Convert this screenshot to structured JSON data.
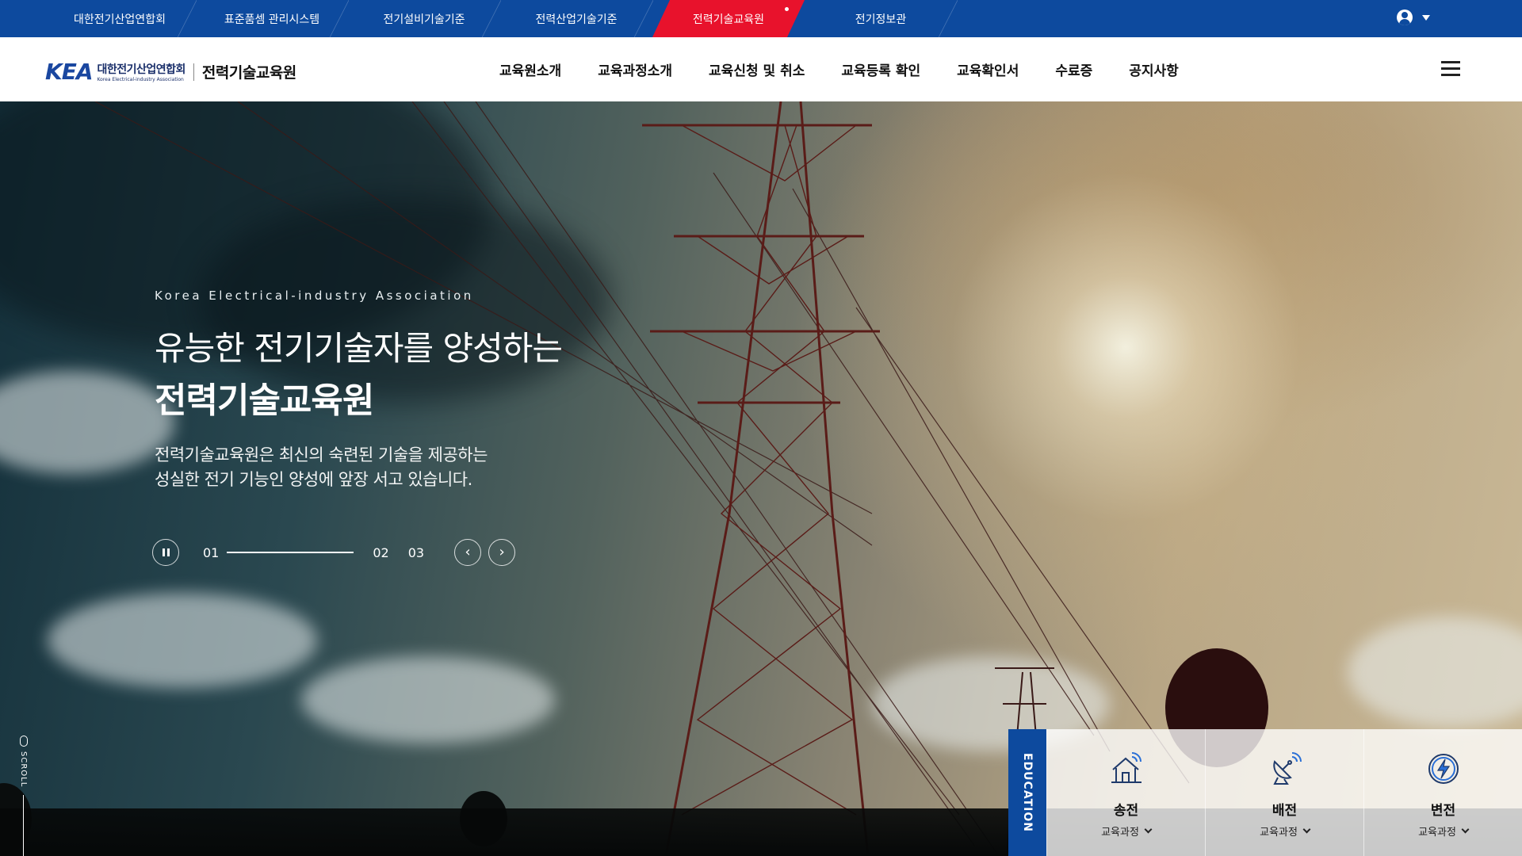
{
  "topbar": {
    "sites": [
      {
        "label": "대한전기산업연합회",
        "active": false
      },
      {
        "label": "표준품셈 관리시스템",
        "active": false
      },
      {
        "label": "전기설비기술기준",
        "active": false
      },
      {
        "label": "전력산업기술기준",
        "active": false
      },
      {
        "label": "전력기술교육원",
        "active": true
      },
      {
        "label": "전기정보관",
        "active": false
      }
    ]
  },
  "header": {
    "logo_mark": "KEA",
    "logo_org": "대한전기산업연합회",
    "logo_org_en": "Korea Electrical-industry Association",
    "logo_sub": "전력기술교육원",
    "nav": [
      "교육원소개",
      "교육과정소개",
      "교육신청 및 취소",
      "교육등록 확인",
      "교육확인서",
      "수료증",
      "공지사항"
    ]
  },
  "hero": {
    "eyebrow": "Korea Electrical-industry Association",
    "title_line1": "유능한 전기기술자를 양성하는",
    "title_line2": "전력기술교육원",
    "desc_line1": "전력기술교육원은 최신의 숙련된 기술을 제공하는",
    "desc_line2": "성실한 전기 기능인 양성에 앞장 서고 있습니다.",
    "slider": {
      "current": "01",
      "others": [
        "02",
        "03"
      ],
      "progress": 1.0
    },
    "scroll_label": "SCROLL"
  },
  "education": {
    "tab_label": "EDUCATION",
    "cards": [
      {
        "title": "송전",
        "sub": "교육과정",
        "icon": "house-signal-icon"
      },
      {
        "title": "배전",
        "sub": "교육과정",
        "icon": "satellite-dish-icon"
      },
      {
        "title": "변전",
        "sub": "교육과정",
        "icon": "lightning-bolt-icon"
      }
    ]
  },
  "colors": {
    "primary_blue": "#0d4a9e",
    "accent_red": "#e8122c"
  }
}
